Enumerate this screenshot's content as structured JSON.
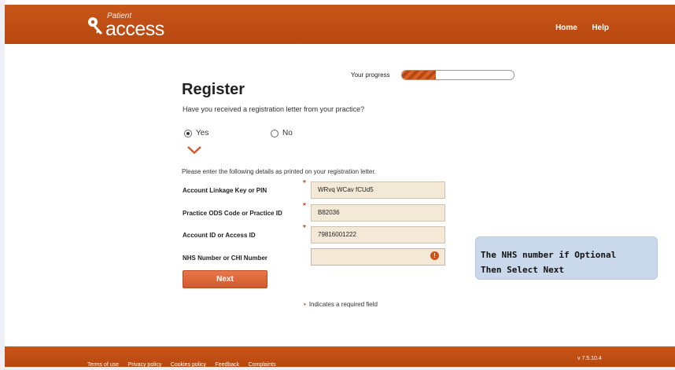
{
  "header": {
    "logo_small": "Patient",
    "logo_big": "access",
    "nav": [
      "Home",
      "Help"
    ]
  },
  "progress": {
    "label": "Your progress",
    "fraction": 0.3
  },
  "form": {
    "title": "Register",
    "question": "Have you received a registration letter from your practice?",
    "options": [
      {
        "label": "Yes",
        "checked": true
      },
      {
        "label": "No",
        "checked": false
      }
    ],
    "instructions": "Please enter the following details as printed on your registration letter.",
    "fields": [
      {
        "label": "Account Linkage Key or PIN",
        "value": "WRvq WCav fCUd5",
        "required": true
      },
      {
        "label": "Practice ODS Code or Practice ID",
        "value": "B82036",
        "required": true
      },
      {
        "label": "Account ID or Access ID",
        "value": "79816001222",
        "required": true
      },
      {
        "label": "NHS Number or CHI Number",
        "value": "",
        "required": false
      }
    ],
    "warning_icon": "!",
    "next_label": "Next",
    "required_note": "Indicates a required field",
    "required_marker": "*",
    "required_dot": "•"
  },
  "callout": {
    "line1": "The NHS number if Optional",
    "line2": "Then Select Next"
  },
  "footer": {
    "links": [
      "Terms of use",
      "Privacy policy",
      "Cookies policy",
      "Feedback",
      "Complaints"
    ],
    "version": "v 7.5.10.4"
  },
  "colors": {
    "brand": "#c8561b",
    "field_bg": "#f4e9d6",
    "callout_bg": "#c9d8ea"
  }
}
